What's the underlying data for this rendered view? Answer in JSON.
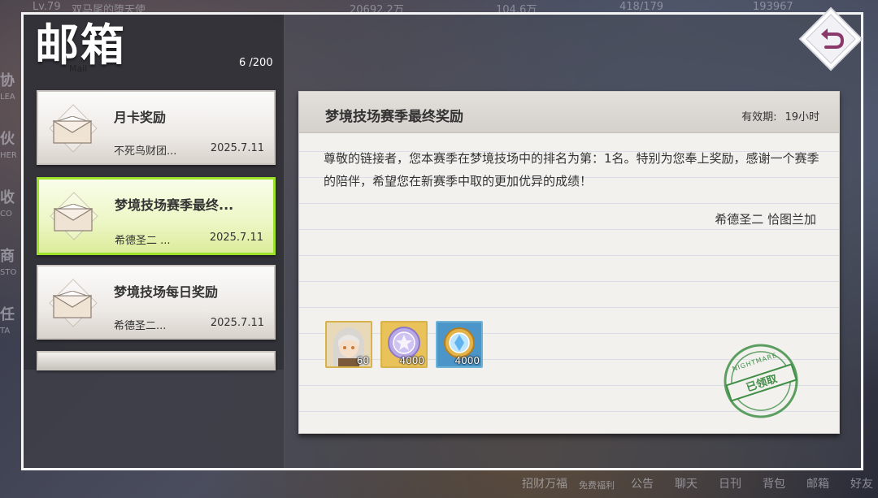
{
  "header": {
    "title": "邮箱",
    "subtitle": "Mail",
    "mail_count": "6 /200"
  },
  "background_hud": {
    "level": "Lv.79",
    "player_name": "双马尾的堕天使",
    "res1": "20692.2万",
    "res2": "104.6万",
    "res3": "418/179",
    "res4": "193967"
  },
  "background_left_labels": [
    {
      "cn": "协",
      "en": "LEA"
    },
    {
      "cn": "伙",
      "en": "HER"
    },
    {
      "cn": "收",
      "en": "CO"
    },
    {
      "cn": "商",
      "en": "STO"
    },
    {
      "cn": "任",
      "en": "TA"
    }
  ],
  "background_menu": [
    "招财万福",
    "免费福利",
    "公告",
    "聊天",
    "日刊",
    "背包",
    "邮箱",
    "好友"
  ],
  "mail_list": [
    {
      "title": "月卡奖励",
      "sender": "不死鸟财团...",
      "date": "2025.7.11",
      "selected": false
    },
    {
      "title": "梦境技场赛季最终...",
      "sender": "希德圣二 ...",
      "date": "2025.7.11",
      "selected": true
    },
    {
      "title": "梦境技场每日奖励",
      "sender": "希德圣二...",
      "date": "2025.7.11",
      "selected": false
    }
  ],
  "letter": {
    "title": "梦境技场赛季最终奖励",
    "validity_label": "有效期:",
    "validity_value": "19小时",
    "body": "尊敬的链接者，您本赛季在梦境技场中的排名为第：1名。特别为您奉上奖励，感谢一个赛季的陪伴，希望您在新赛季中取的更加优异的成绩！",
    "signature": "希德圣二 恰图兰加",
    "rewards": [
      {
        "icon": "character-portrait-icon",
        "qty": "60"
      },
      {
        "icon": "purple-medal-icon",
        "qty": "4000"
      },
      {
        "icon": "blue-gem-coin-icon",
        "qty": "4000"
      }
    ],
    "stamp_text": "已领取",
    "stamp_ring_text": "NIGHTMARE"
  },
  "colors": {
    "selected_border": "#9ee22a",
    "back_icon": "#8a3a6a",
    "stamp": "#3f8f47"
  }
}
